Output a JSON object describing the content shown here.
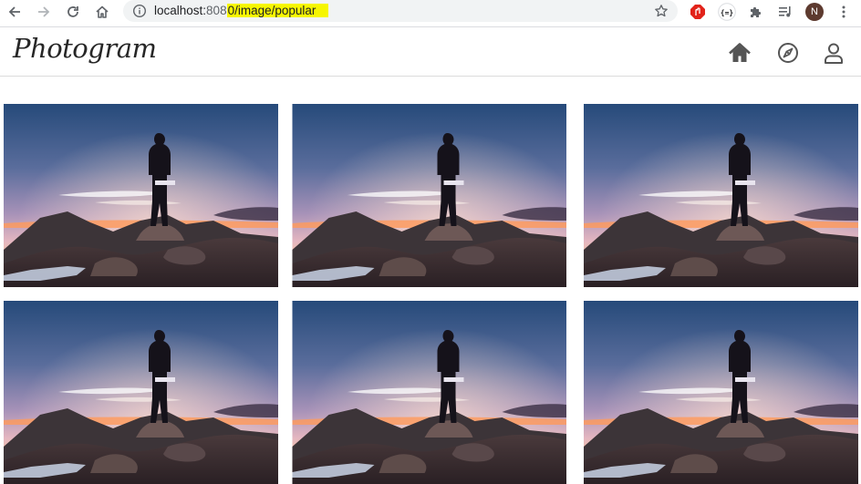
{
  "browser": {
    "url_host": "localhost:",
    "url_port": "808",
    "url_path": "0/image/popular",
    "profile_initial": "N",
    "colors": {
      "highlight": "#f6f600",
      "profile": "#5d3a2f",
      "adblock": "#e2231a"
    },
    "icons": [
      "back-arrow-icon",
      "forward-arrow-icon",
      "reload-icon",
      "home-icon",
      "info-icon",
      "star-icon",
      "adblock-icon",
      "json-viewer-icon",
      "puzzle-icon",
      "media-playlist-icon",
      "kebab-menu-icon"
    ]
  },
  "app": {
    "logo_text": "Photogram",
    "nav_icons": [
      "home-icon",
      "compass-icon",
      "user-icon"
    ]
  },
  "gallery": {
    "images": [
      {
        "alt": "hiker-at-sunset"
      },
      {
        "alt": "hiker-at-sunset"
      },
      {
        "alt": "hiker-at-sunset"
      },
      {
        "alt": "hiker-at-sunset"
      },
      {
        "alt": "hiker-at-sunset"
      },
      {
        "alt": "hiker-at-sunset"
      }
    ]
  }
}
